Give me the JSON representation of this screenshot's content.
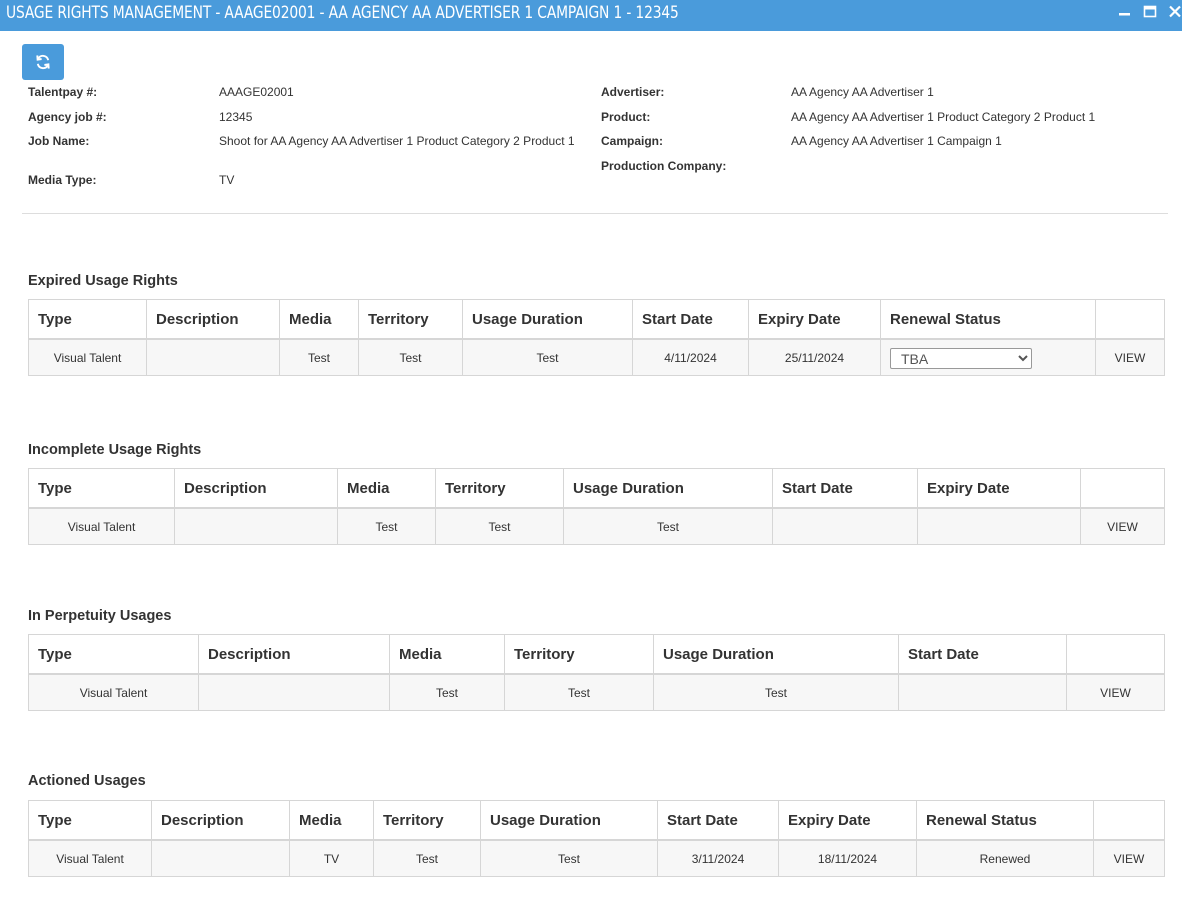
{
  "window": {
    "title": "USAGE RIGHTS MANAGEMENT - AAAGE02001 - AA AGENCY AA ADVERTISER 1 CAMPAIGN 1 - 12345"
  },
  "toolbar": {
    "refresh_icon": "refresh-icon"
  },
  "info": {
    "talentpay_label": "Talentpay #:",
    "talentpay_value": "AAAGE02001",
    "agency_job_label": "Agency job #:",
    "agency_job_value": "12345",
    "job_name_label": "Job Name:",
    "job_name_value": "Shoot for AA Agency AA Advertiser 1 Product Category 2 Product 1",
    "media_type_label": "Media Type:",
    "media_type_value": "TV",
    "advertiser_label": "Advertiser:",
    "advertiser_value": "AA Agency AA Advertiser 1",
    "product_label": "Product:",
    "product_value": "AA Agency AA Advertiser 1 Product Category 2 Product 1",
    "campaign_label": "Campaign:",
    "campaign_value": "AA Agency AA Advertiser 1 Campaign 1",
    "production_company_label": "Production Company:",
    "production_company_value": ""
  },
  "expired": {
    "title": "Expired Usage Rights",
    "headers": [
      "Type",
      "Description",
      "Media",
      "Territory",
      "Usage Duration",
      "Start Date",
      "Expiry Date",
      "Renewal Status",
      ""
    ],
    "row": {
      "type": "Visual Talent",
      "description": "",
      "media": "Test",
      "territory": "Test",
      "usage_duration": "Test",
      "start_date": "4/11/2024",
      "expiry_date": "25/11/2024",
      "renewal_status": "TBA",
      "action": "VIEW"
    }
  },
  "incomplete": {
    "title": "Incomplete Usage Rights",
    "headers": [
      "Type",
      "Description",
      "Media",
      "Territory",
      "Usage Duration",
      "Start Date",
      "Expiry Date",
      ""
    ],
    "row": {
      "type": "Visual Talent",
      "description": "",
      "media": "Test",
      "territory": "Test",
      "usage_duration": "Test",
      "start_date": "",
      "expiry_date": "",
      "action": "VIEW"
    }
  },
  "perpetuity": {
    "title": "In Perpetuity Usages",
    "headers": [
      "Type",
      "Description",
      "Media",
      "Territory",
      "Usage Duration",
      "Start Date",
      ""
    ],
    "row": {
      "type": "Visual Talent",
      "description": "",
      "media": "Test",
      "territory": "Test",
      "usage_duration": "Test",
      "start_date": "",
      "action": "VIEW"
    }
  },
  "actioned": {
    "title": "Actioned Usages",
    "headers": [
      "Type",
      "Description",
      "Media",
      "Territory",
      "Usage Duration",
      "Start Date",
      "Expiry Date",
      "Renewal Status",
      ""
    ],
    "row": {
      "type": "Visual Talent",
      "description": "",
      "media": "TV",
      "territory": "Test",
      "usage_duration": "Test",
      "start_date": "3/11/2024",
      "expiry_date": "18/11/2024",
      "renewal_status": "Renewed",
      "action": "VIEW"
    }
  },
  "colors": {
    "accent": "#4a9bdb",
    "link": "#3f7fc4"
  }
}
